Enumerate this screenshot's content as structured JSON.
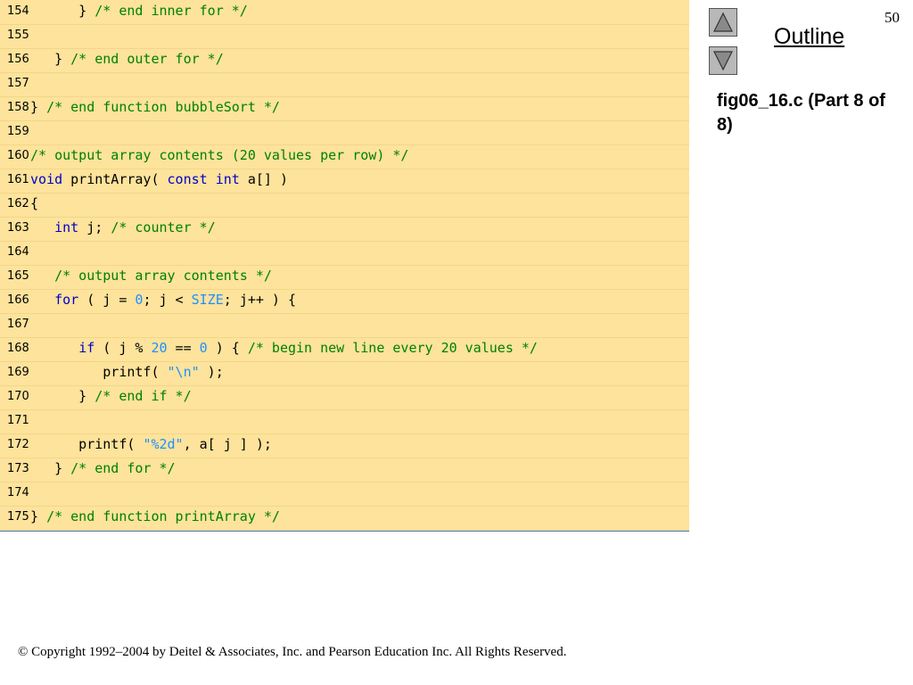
{
  "slide_number": "50",
  "outline_label": "Outline",
  "caption": "fig06_16.c (Part 8 of 8)",
  "copyright": "© Copyright 1992–2004 by Deitel & Associates, Inc. and Pearson Education Inc. All Rights Reserved.",
  "nav": {
    "up_icon": "triangle-up-icon",
    "down_icon": "triangle-down-icon"
  },
  "code_lines": [
    {
      "num": "154",
      "tokens": [
        {
          "t": "      } ",
          "c": ""
        },
        {
          "t": "/* end inner for */",
          "c": "cm"
        }
      ]
    },
    {
      "num": "155",
      "tokens": []
    },
    {
      "num": "156",
      "tokens": [
        {
          "t": "   } ",
          "c": ""
        },
        {
          "t": "/* end outer for */",
          "c": "cm"
        }
      ]
    },
    {
      "num": "157",
      "tokens": []
    },
    {
      "num": "158",
      "tokens": [
        {
          "t": "} ",
          "c": ""
        },
        {
          "t": "/* end function bubbleSort */",
          "c": "cm"
        }
      ]
    },
    {
      "num": "159",
      "tokens": []
    },
    {
      "num": "160",
      "tokens": [
        {
          "t": "/* output array contents (20 values per row) */",
          "c": "cm"
        }
      ]
    },
    {
      "num": "161",
      "tokens": [
        {
          "t": "void",
          "c": "kw"
        },
        {
          "t": " printArray( ",
          "c": ""
        },
        {
          "t": "const",
          "c": "kw"
        },
        {
          "t": " ",
          "c": ""
        },
        {
          "t": "int",
          "c": "kw"
        },
        {
          "t": " a[] )",
          "c": ""
        }
      ]
    },
    {
      "num": "162",
      "tokens": [
        {
          "t": "{",
          "c": ""
        }
      ]
    },
    {
      "num": "163",
      "tokens": [
        {
          "t": "   ",
          "c": ""
        },
        {
          "t": "int",
          "c": "kw"
        },
        {
          "t": " j; ",
          "c": ""
        },
        {
          "t": "/* counter */",
          "c": "cm"
        }
      ]
    },
    {
      "num": "164",
      "tokens": []
    },
    {
      "num": "165",
      "tokens": [
        {
          "t": "   ",
          "c": ""
        },
        {
          "t": "/* output array contents */",
          "c": "cm"
        }
      ]
    },
    {
      "num": "166",
      "tokens": [
        {
          "t": "   ",
          "c": ""
        },
        {
          "t": "for",
          "c": "kw"
        },
        {
          "t": " ( j = ",
          "c": ""
        },
        {
          "t": "0",
          "c": "lit"
        },
        {
          "t": "; j < ",
          "c": ""
        },
        {
          "t": "SIZE",
          "c": "lit"
        },
        {
          "t": "; j++ ) {",
          "c": ""
        }
      ]
    },
    {
      "num": "167",
      "tokens": []
    },
    {
      "num": "168",
      "tokens": [
        {
          "t": "      ",
          "c": ""
        },
        {
          "t": "if",
          "c": "kw"
        },
        {
          "t": " ( j % ",
          "c": ""
        },
        {
          "t": "20",
          "c": "lit"
        },
        {
          "t": " == ",
          "c": ""
        },
        {
          "t": "0",
          "c": "lit"
        },
        {
          "t": " ) { ",
          "c": ""
        },
        {
          "t": "/* begin new line every 20 values */",
          "c": "cm"
        }
      ]
    },
    {
      "num": "169",
      "tokens": [
        {
          "t": "         printf( ",
          "c": ""
        },
        {
          "t": "\"\\n\"",
          "c": "lit"
        },
        {
          "t": " );",
          "c": ""
        }
      ]
    },
    {
      "num": "170",
      "tokens": [
        {
          "t": "      } ",
          "c": ""
        },
        {
          "t": "/* end if */",
          "c": "cm"
        }
      ]
    },
    {
      "num": "171",
      "tokens": []
    },
    {
      "num": "172",
      "tokens": [
        {
          "t": "      printf( ",
          "c": ""
        },
        {
          "t": "\"%2d\"",
          "c": "lit"
        },
        {
          "t": ", a[ j ] );",
          "c": ""
        }
      ]
    },
    {
      "num": "173",
      "tokens": [
        {
          "t": "   } ",
          "c": ""
        },
        {
          "t": "/* end for */",
          "c": "cm"
        }
      ]
    },
    {
      "num": "174",
      "tokens": []
    },
    {
      "num": "175",
      "tokens": [
        {
          "t": "} ",
          "c": ""
        },
        {
          "t": "/* end function printArray */",
          "c": "cm"
        }
      ]
    }
  ]
}
